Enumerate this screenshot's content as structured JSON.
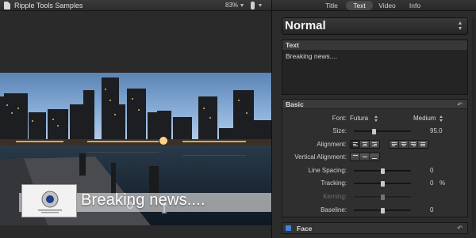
{
  "viewer": {
    "title": "Ripple Tools Samples",
    "zoom": "83%",
    "lower_third_text": "Breaking news...."
  },
  "inspector": {
    "tabs": [
      {
        "label": "Title",
        "active": false
      },
      {
        "label": "Text",
        "active": true
      },
      {
        "label": "Video",
        "active": false
      },
      {
        "label": "Info",
        "active": false
      }
    ],
    "preset": "Normal",
    "text_section": {
      "header": "Text",
      "value": "Breaking news...."
    },
    "basic": {
      "header": "Basic",
      "font_label": "Font:",
      "font_name": "Futura",
      "font_weight": "Medium",
      "size_label": "Size:",
      "size_value": "95.0",
      "size_level": 0.35,
      "alignment_label": "Alignment:",
      "vertical_alignment_label": "Vertical Alignment:",
      "line_spacing_label": "Line Spacing:",
      "line_spacing_value": "0",
      "line_spacing_level": 0.5,
      "tracking_label": "Tracking:",
      "tracking_value": "0",
      "tracking_unit": "%",
      "tracking_level": 0.5,
      "kerning_label": "Kerning:",
      "kerning_level": 0.5,
      "baseline_label": "Baseline:",
      "baseline_value": "0",
      "baseline_level": 0.5
    },
    "face_section": {
      "label": "Face",
      "enabled": true
    }
  },
  "colors": {
    "accent": "#3d84e3",
    "panel": "#2c2c2c",
    "sky": "#7fa9d8"
  }
}
